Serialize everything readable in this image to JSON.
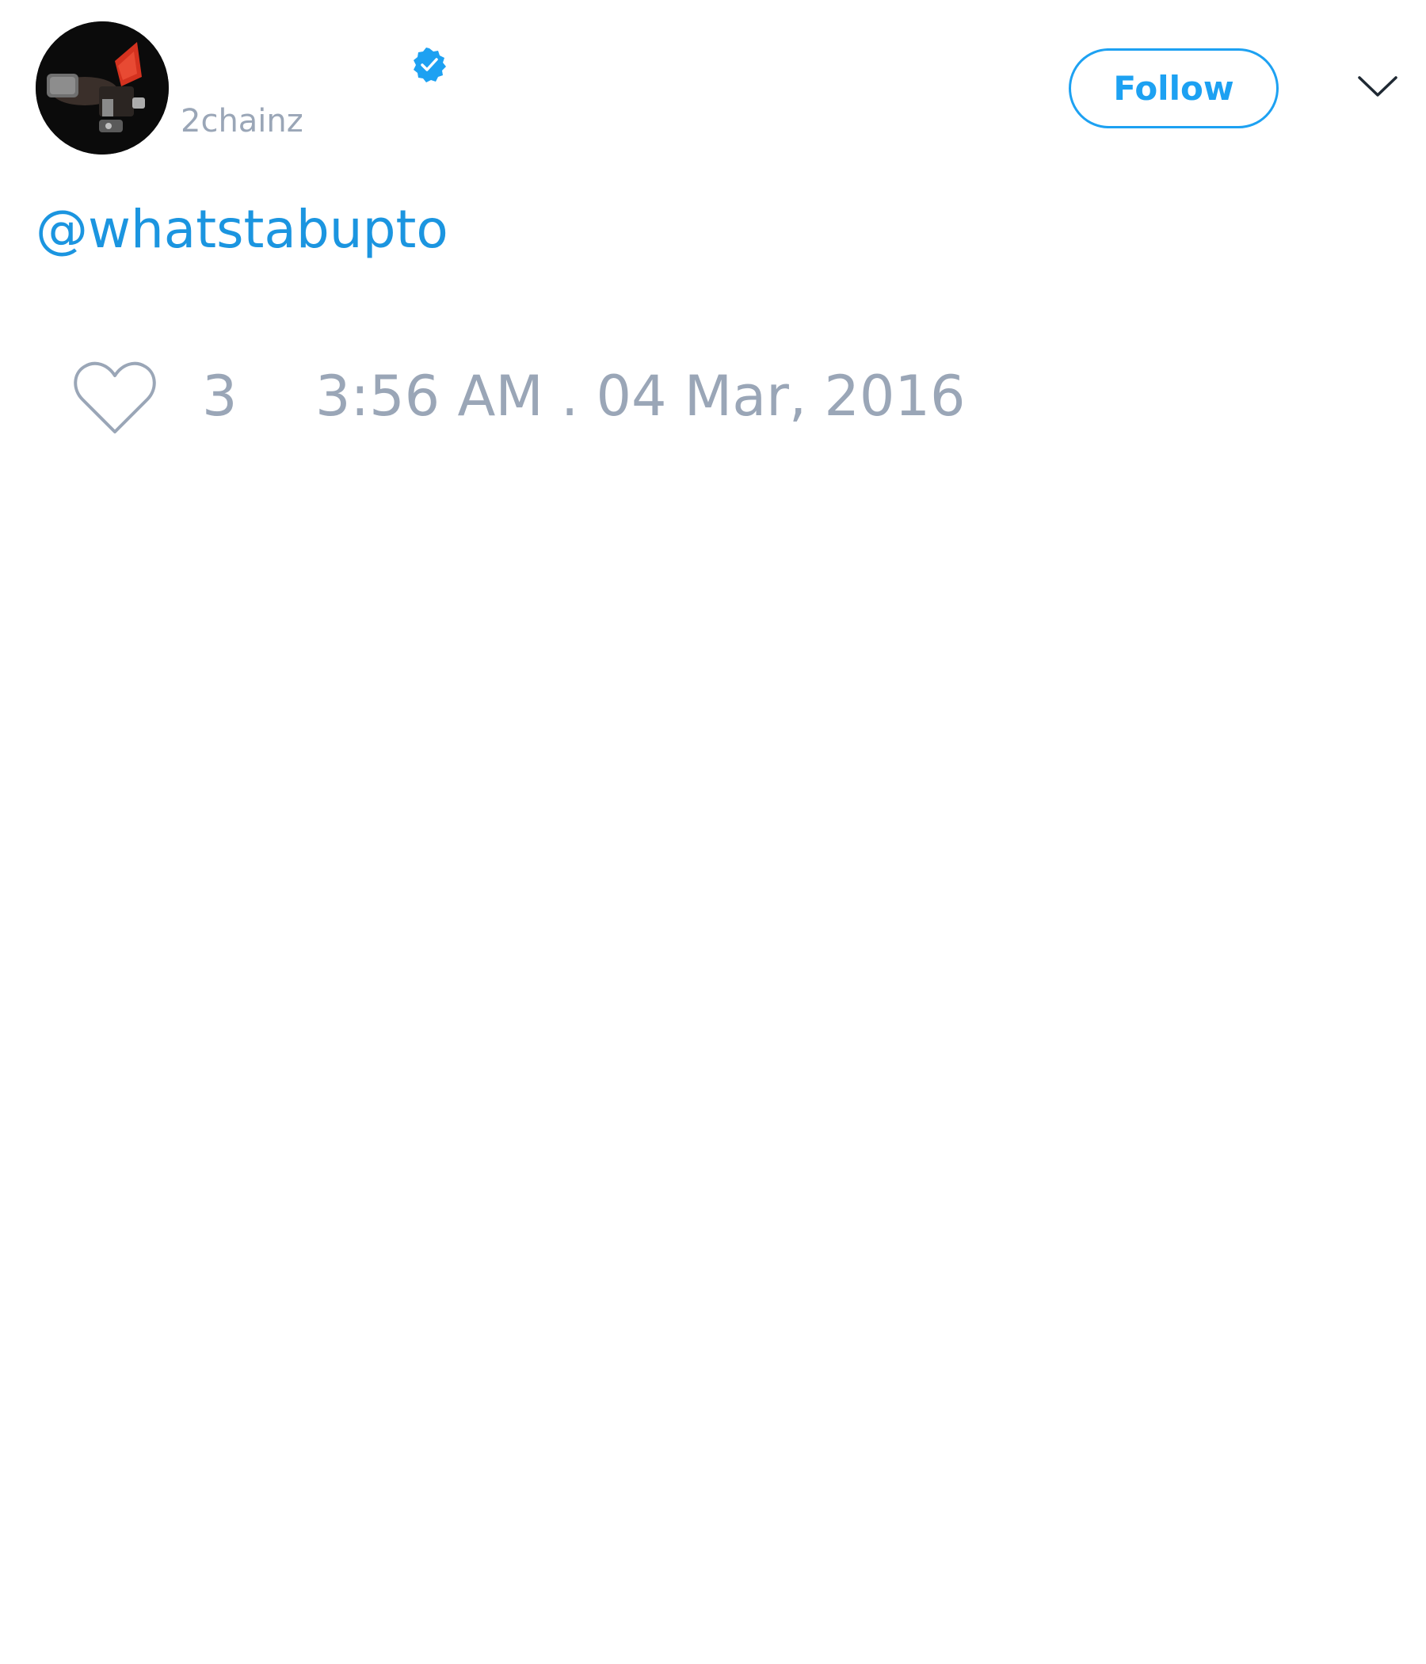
{
  "tweet": {
    "author": {
      "handle": "2chainz",
      "display_name": "",
      "verified": true,
      "avatar_icon": "profile-photo"
    },
    "follow_label": "Follow",
    "menu_icon": "chevron-down-icon",
    "text": "@whatstabupto",
    "likes": "3",
    "timestamp": "3:56 AM . 04 Mar, 2016"
  },
  "colors": {
    "accent": "#1da1f2",
    "link": "#1b95e0",
    "muted": "#9aa6b7",
    "background": "#ffffff"
  }
}
